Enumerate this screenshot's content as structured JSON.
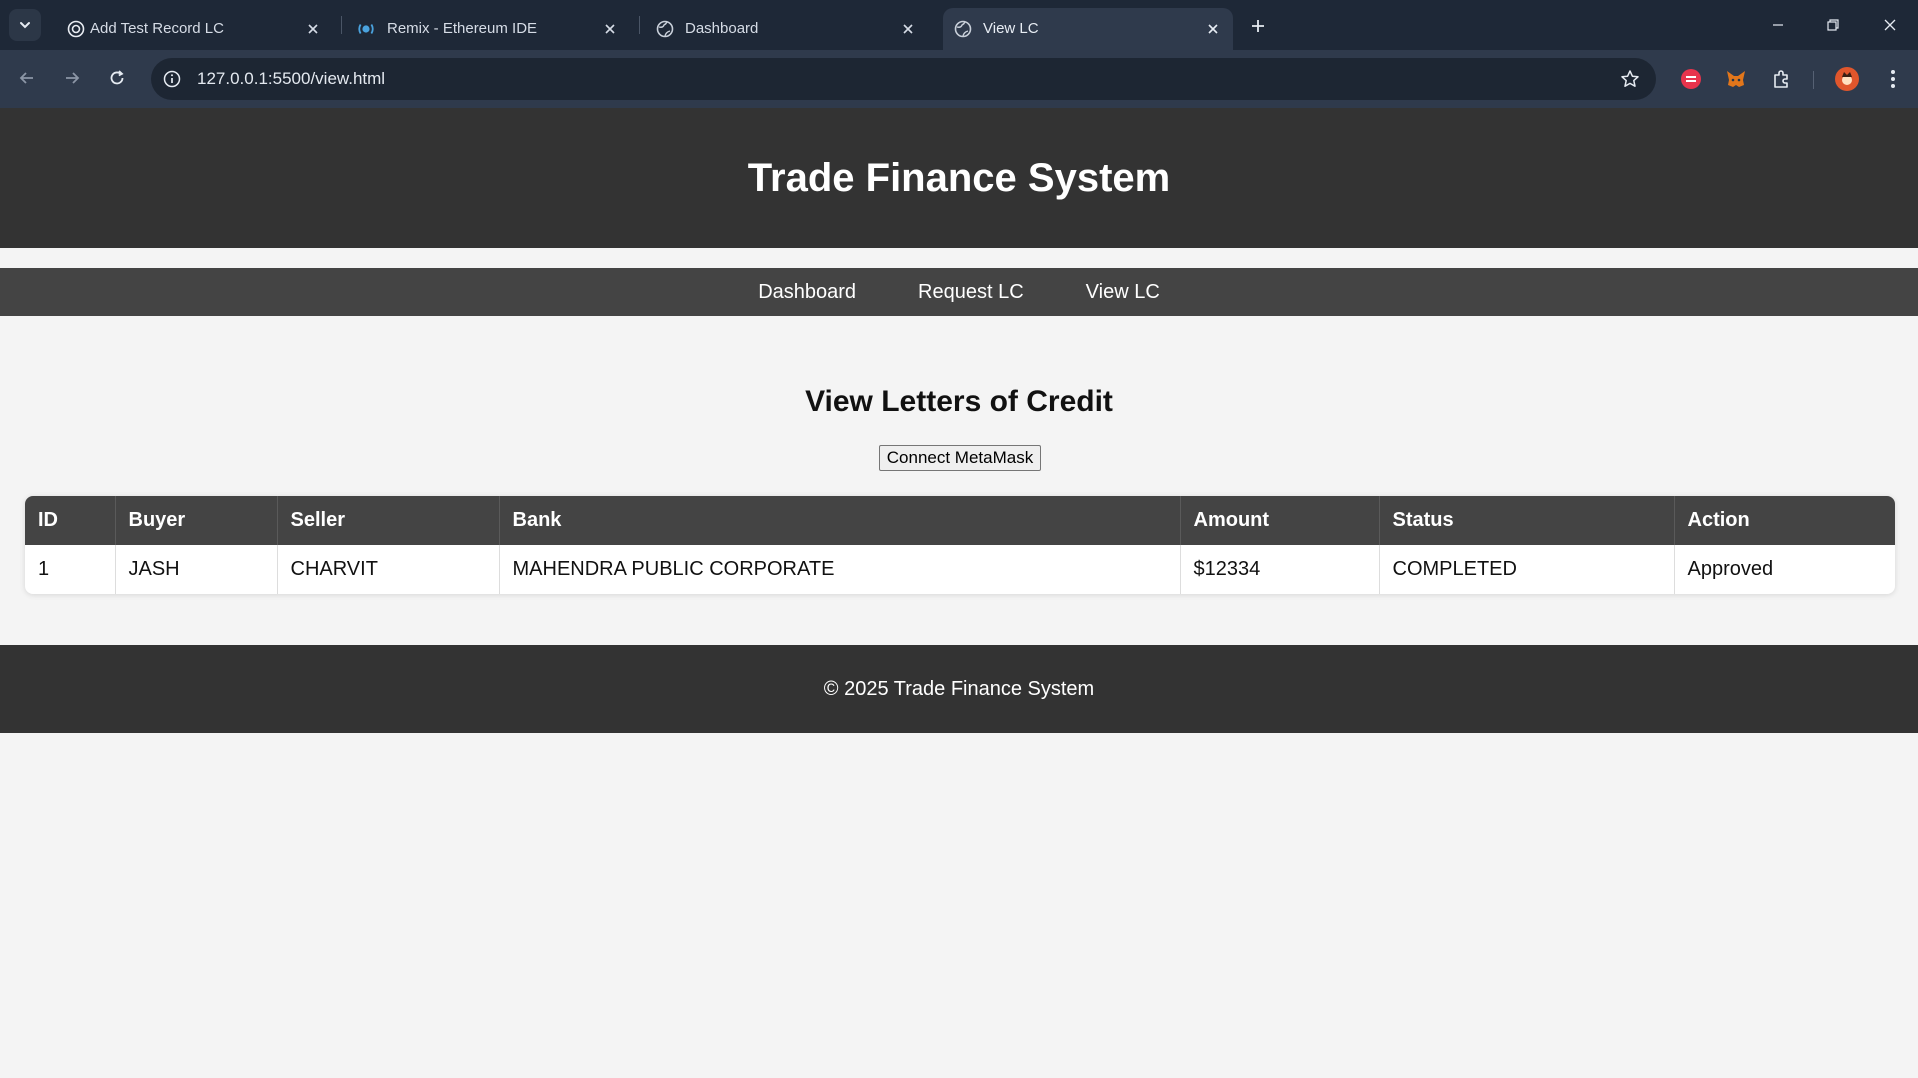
{
  "browser": {
    "tabs": [
      {
        "title": "Add Test Record LC",
        "icon": "openai-icon",
        "active": false
      },
      {
        "title": "Remix - Ethereum IDE",
        "icon": "remix-icon",
        "active": false
      },
      {
        "title": "Dashboard",
        "icon": "globe-icon",
        "active": false
      },
      {
        "title": "View LC",
        "icon": "globe-icon",
        "active": true
      }
    ],
    "url": "127.0.0.1:5500/view.html",
    "colors": {
      "tabstrip": "#1e2837",
      "toolbar": "#2f3a4c",
      "omnibox": "#1d2633"
    }
  },
  "site": {
    "header_title": "Trade Finance System",
    "nav": [
      "Dashboard",
      "Request LC",
      "View LC"
    ],
    "page_title": "View Letters of Credit",
    "connect_button": "Connect MetaMask",
    "table": {
      "headers": [
        "ID",
        "Buyer",
        "Seller",
        "Bank",
        "Amount",
        "Status",
        "Action"
      ],
      "rows": [
        [
          "1",
          "JASH",
          "CHARVIT",
          "MAHENDRA PUBLIC CORPORATE",
          "$12334",
          "COMPLETED",
          "Approved"
        ]
      ]
    },
    "footer": "© 2025 Trade Finance System",
    "colors": {
      "header_bg": "#333333",
      "nav_bg": "#444444",
      "page_bg": "#f4f4f4"
    }
  }
}
